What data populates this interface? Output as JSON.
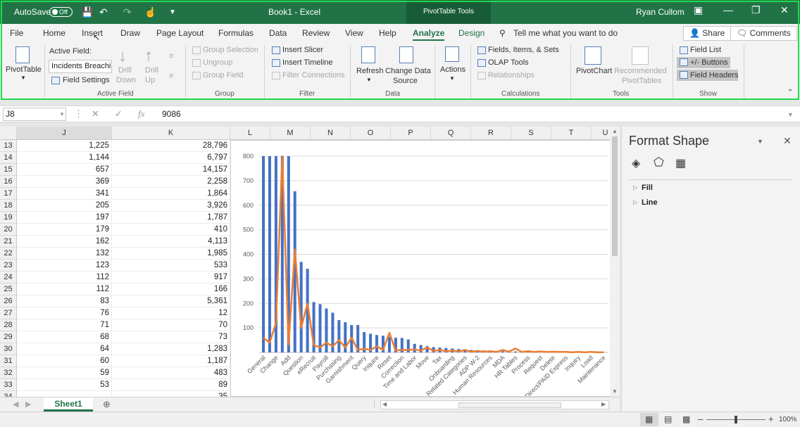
{
  "titlebar": {
    "autosave_label": "AutoSave",
    "autosave_state": "Off",
    "title": "Book1  -  Excel",
    "contextual_tab": "PivotTable Tools",
    "user": "Ryan Cullom"
  },
  "tabs": [
    "File",
    "Home",
    "Insert",
    "Draw",
    "Page Layout",
    "Formulas",
    "Data",
    "Review",
    "View",
    "Help",
    "Analyze",
    "Design"
  ],
  "tellme": "Tell me what you want to do",
  "share_label": "Share",
  "comments_label": "Comments",
  "ribbon": {
    "pivottable": "PivotTable",
    "active_field_label": "Active Field:",
    "active_field_value": "Incidents Breaching",
    "field_settings": "Field Settings",
    "drill_down_1": "Drill",
    "drill_down_2": "Down",
    "drill_up_1": "Drill",
    "drill_up_2": "Up",
    "group_active_field": "Active Field",
    "group_selection": "Group Selection",
    "ungroup": "Ungroup",
    "group_field": "Group Field",
    "group_group": "Group",
    "insert_slicer": "Insert Slicer",
    "insert_timeline": "Insert Timeline",
    "filter_connections": "Filter Connections",
    "group_filter": "Filter",
    "refresh": "Refresh",
    "change_data_source_1": "Change Data",
    "change_data_source_2": "Source",
    "group_data": "Data",
    "actions": "Actions",
    "fields_items_sets": "Fields, Items, & Sets",
    "olap_tools": "OLAP Tools",
    "relationships": "Relationships",
    "group_calculations": "Calculations",
    "pivotchart": "PivotChart",
    "recommended_1": "Recommended",
    "recommended_2": "PivotTables",
    "group_tools": "Tools",
    "field_list": "Field List",
    "buttons": "+/- Buttons",
    "field_headers": "Field Headers",
    "group_show": "Show"
  },
  "formula_bar": {
    "name_box": "J8",
    "fx": "fx",
    "value": "9086"
  },
  "columns": [
    "J",
    "K",
    "L",
    "M",
    "N",
    "O",
    "P",
    "Q",
    "R",
    "S",
    "T",
    "U"
  ],
  "rows": [
    {
      "n": "13",
      "j": "1,225",
      "k": "28,796"
    },
    {
      "n": "14",
      "j": "1,144",
      "k": "6,797"
    },
    {
      "n": "15",
      "j": "657",
      "k": "14,157"
    },
    {
      "n": "16",
      "j": "369",
      "k": "2,258"
    },
    {
      "n": "17",
      "j": "341",
      "k": "1,864"
    },
    {
      "n": "18",
      "j": "205",
      "k": "3,926"
    },
    {
      "n": "19",
      "j": "197",
      "k": "1,787"
    },
    {
      "n": "20",
      "j": "179",
      "k": "410"
    },
    {
      "n": "21",
      "j": "162",
      "k": "4,113"
    },
    {
      "n": "22",
      "j": "132",
      "k": "1,985"
    },
    {
      "n": "23",
      "j": "123",
      "k": "533"
    },
    {
      "n": "24",
      "j": "112",
      "k": "917"
    },
    {
      "n": "25",
      "j": "112",
      "k": "166"
    },
    {
      "n": "26",
      "j": "83",
      "k": "5,361"
    },
    {
      "n": "27",
      "j": "76",
      "k": "12"
    },
    {
      "n": "28",
      "j": "71",
      "k": "70"
    },
    {
      "n": "29",
      "j": "68",
      "k": "73"
    },
    {
      "n": "30",
      "j": "64",
      "k": "1,283"
    },
    {
      "n": "31",
      "j": "60",
      "k": "1,187"
    },
    {
      "n": "32",
      "j": "59",
      "k": "483"
    },
    {
      "n": "33",
      "j": "53",
      "k": "89"
    },
    {
      "n": "34",
      "j": "",
      "k": "35"
    }
  ],
  "chart_data": {
    "type": "bar",
    "ylim": [
      0,
      800
    ],
    "yticks": [
      100,
      200,
      300,
      400,
      500,
      600,
      700,
      800
    ],
    "grid": true,
    "categories": [
      "General",
      "Change",
      "Add",
      "Question",
      "eRecruit",
      "Payroll",
      "Purchasing",
      "Garnishment",
      "Query",
      "Inquire",
      "Reset",
      "Correction",
      "Time and Labor",
      "Move",
      "Tax",
      "Onboarding",
      "Related Categories",
      "ADP W-2",
      "Human Resources",
      "MDA",
      "HR Tables",
      "Process",
      "Request",
      "Delete",
      "Direct/PAID Express",
      "Inquiry",
      "Load",
      "Maintenance"
    ],
    "series": [
      {
        "values": [
          1225,
          1144,
          1000,
          900,
          850,
          657,
          369,
          341,
          205,
          197,
          179,
          162,
          132,
          123,
          112,
          112,
          83,
          76,
          71,
          68,
          64,
          60,
          59,
          53,
          35,
          30,
          26,
          22,
          20,
          18,
          16,
          14,
          12,
          10,
          9,
          8,
          7,
          6,
          5,
          5,
          4,
          4,
          3,
          3,
          3,
          2,
          2,
          2,
          2,
          1,
          1,
          1,
          1,
          1,
          1
        ],
        "color": "#4472c4"
      },
      {
        "values": [
          60,
          40,
          120,
          900,
          30,
          420,
          100,
          200,
          30,
          20,
          40,
          25,
          50,
          20,
          60,
          10,
          15,
          10,
          25,
          10,
          80,
          8,
          10,
          10,
          12,
          8,
          20,
          6,
          10,
          5,
          8,
          4,
          10,
          3,
          6,
          3,
          5,
          2,
          10,
          3,
          16,
          2,
          5,
          2,
          4,
          2,
          3,
          2,
          2,
          1,
          2,
          1,
          2,
          1,
          1
        ],
        "color": "#ed7d31"
      }
    ]
  },
  "sheet_tab": "Sheet1",
  "pane": {
    "title": "Format Shape",
    "fill": "Fill",
    "line": "Line"
  },
  "zoom": "100%"
}
